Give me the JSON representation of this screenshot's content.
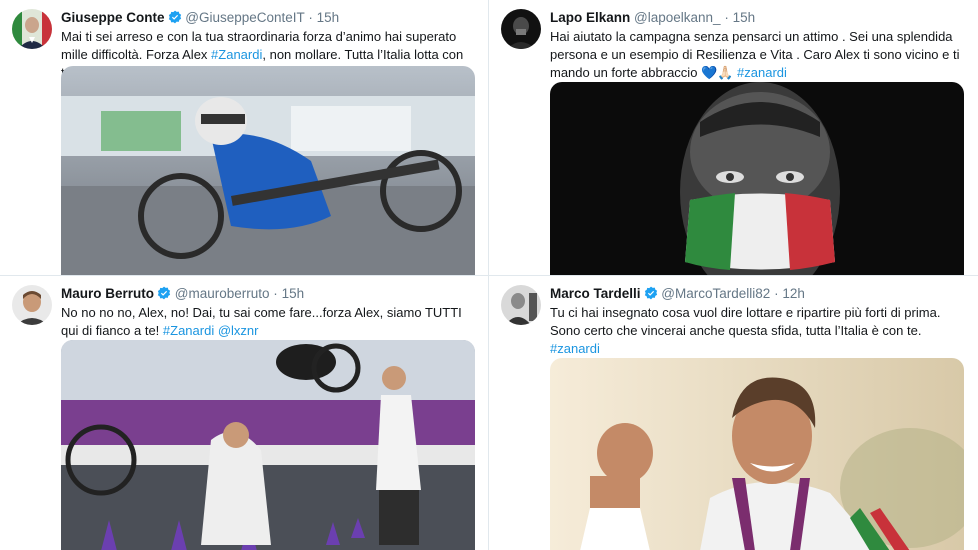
{
  "tweets": [
    {
      "name": "Giuseppe Conte",
      "verified": true,
      "handle": "@GiuseppeConteIT",
      "time": "15h",
      "text_parts": [
        "Mai ti sei arreso e con la tua straordinaria forza d’animo hai superato mille difficoltà. Forza Alex ",
        "#Zanardi",
        ", non mollare. Tutta l’Italia lotta con te."
      ]
    },
    {
      "name": "Lapo Elkann",
      "verified": false,
      "handle": "@lapoelkann_",
      "time": "15h",
      "text_parts": [
        "Hai aiutato la campagna senza pensarci un attimo . Sei una splendida persona e un esempio di Resilienza e Vita . Caro Alex ti sono vicino e ti mando un forte abbraccio ",
        "💙🙏🏻",
        " #zanardi"
      ]
    },
    {
      "name": "Mauro Berruto",
      "verified": true,
      "handle": "@mauroberruto",
      "time": "15h",
      "text_parts": [
        "No no no no, Alex, no! Dai, tu sai come fare...forza Alex, siamo TUTTI qui di fianco a te! ",
        "#Zanardi",
        " ",
        "@lxznr"
      ]
    },
    {
      "name": "Marco Tardelli",
      "verified": true,
      "handle": "@MarcoTardelli82",
      "time": "12h",
      "text_parts": [
        "Tu ci hai insegnato cosa vuol dire lottare e ripartire più forti di prima. Sono certo che vincerai anche questa sfida, tutta l’Italia è con te. ",
        "#zanardi"
      ]
    }
  ],
  "separator": "·",
  "colors": {
    "link": "#1b95e0",
    "muted": "#657786",
    "verified": "#1da1f2",
    "divider": "#e1e8ed"
  },
  "icons": [
    "verified-badge-icon"
  ]
}
